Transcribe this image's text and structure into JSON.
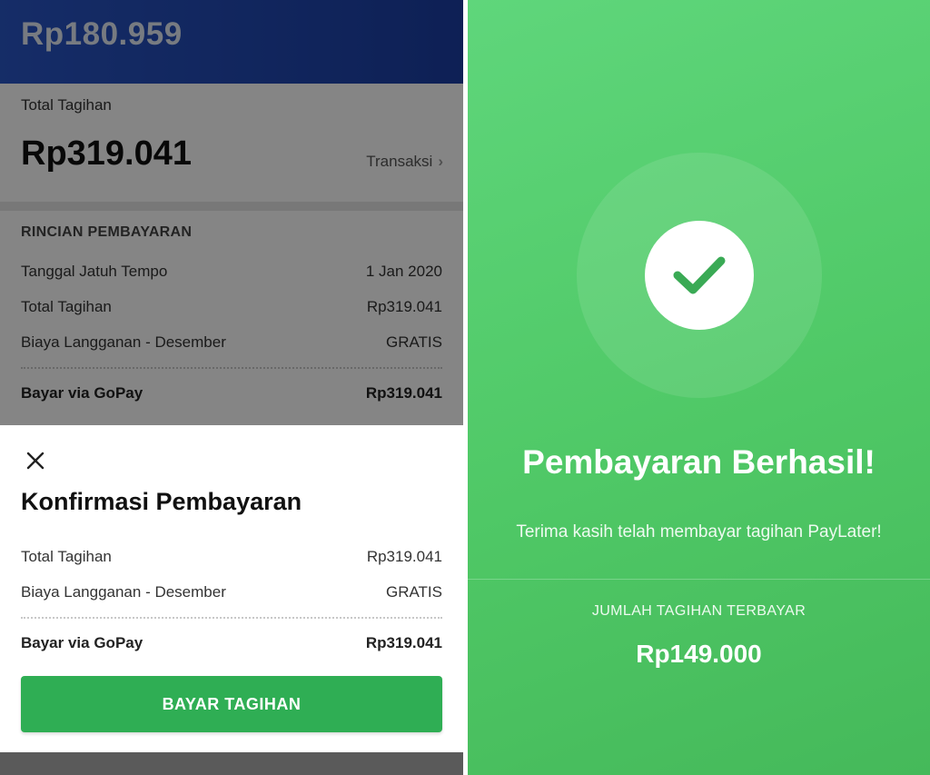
{
  "left": {
    "header_amount": "Rp180.959",
    "total_label": "Total Tagihan",
    "total_amount": "Rp319.041",
    "transaksi_label": "Transaksi",
    "details": {
      "heading": "RINCIAN PEMBAYARAN",
      "rows": [
        {
          "label": "Tanggal Jatuh Tempo",
          "value": "1 Jan 2020"
        },
        {
          "label": "Total Tagihan",
          "value": "Rp319.041"
        },
        {
          "label": "Biaya Langganan - Desember",
          "value": "GRATIS"
        }
      ],
      "total_row": {
        "label": "Bayar via GoPay",
        "value": "Rp319.041"
      }
    }
  },
  "sheet": {
    "close_icon": "close-icon",
    "title": "Konfirmasi Pembayaran",
    "rows": [
      {
        "label": "Total Tagihan",
        "value": "Rp319.041"
      },
      {
        "label": "Biaya Langganan - Desember",
        "value": "GRATIS"
      }
    ],
    "total_row": {
      "label": "Bayar via GoPay",
      "value": "Rp319.041"
    },
    "button_label": "BAYAR TAGIHAN"
  },
  "right": {
    "check_icon": "checkmark-icon",
    "title": "Pembayaran Berhasil!",
    "subtitle": "Terima kasih telah membayar tagihan PayLater!",
    "paid_label": "JUMLAH TAGIHAN TERBAYAR",
    "paid_amount": "Rp149.000"
  },
  "colors": {
    "header_blue": "#1b3ea4",
    "success_green": "#4fc866",
    "button_green": "#2fae54"
  }
}
